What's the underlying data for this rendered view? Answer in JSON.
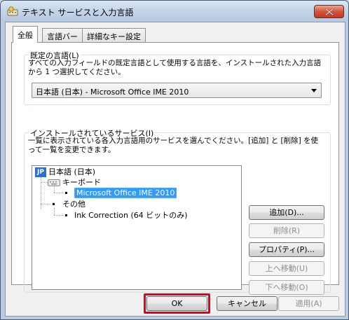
{
  "window": {
    "title": "テキスト サービスと入力言語",
    "accent_close": "#c23a20",
    "highlight": "#e4001b"
  },
  "tabs": [
    {
      "label": "全般",
      "active": true
    },
    {
      "label": "言語バー",
      "active": false
    },
    {
      "label": "詳細なキー設定",
      "active": false
    }
  ],
  "default_language": {
    "group_title": "既定の言語(L)",
    "description_line1": "すべての入力フィールドの既定言語として使用する言語を、インストールされた入力言語",
    "description_line2": "から 1 つ選択してください。",
    "selected": "日本語 (日本) - Microsoft Office IME 2010"
  },
  "installed_services": {
    "group_title": "インストールされているサービス(I)",
    "description_line1": "一覧に表示されている各入力言語用のサービスを選んでください。[追加] と [削除] を使",
    "description_line2": "って一覧を変更できます。",
    "tree": {
      "language_badge": "JP",
      "language": "日本語 (日本)",
      "keyboard_group": "キーボード",
      "keyboard_item": "Microsoft Office IME 2010",
      "other_group": "その他",
      "other_item": "Ink Correction (64 ビットのみ)"
    },
    "buttons": {
      "add": "追加(D)...",
      "remove": "削除(R)",
      "properties": "プロパティ(P)...",
      "move_up": "上へ移動(U)",
      "move_down": "下へ移動(O)"
    }
  },
  "footer": {
    "ok": "OK",
    "cancel": "キャンセル",
    "apply": "適用(A)"
  }
}
